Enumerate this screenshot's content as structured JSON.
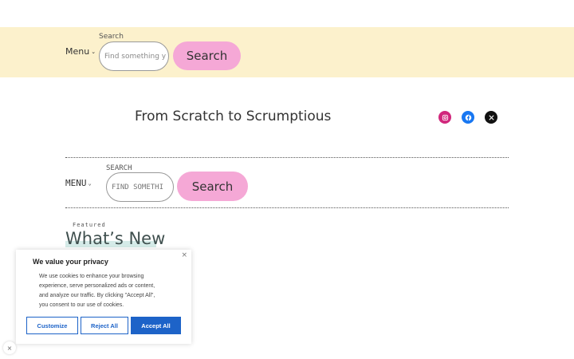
{
  "header": {
    "menu_label": "Menu",
    "search_label": "Search",
    "search_placeholder": "Find something y",
    "search_button": "Search"
  },
  "site": {
    "title": "From Scratch to Scrumptious"
  },
  "social": [
    {
      "name": "instagram-icon",
      "color": "#d1277c"
    },
    {
      "name": "facebook-icon",
      "color": "#1877f2"
    },
    {
      "name": "x-icon",
      "color": "#111111"
    }
  ],
  "nav2": {
    "menu_label": "MENU",
    "search_label": "SEARCH",
    "search_placeholder": "FIND SOMETHI",
    "search_button": "Search"
  },
  "featured": {
    "kicker": "Featured",
    "title": "What’s New"
  },
  "cookie": {
    "close": "×",
    "title": "We value your privacy",
    "lines": [
      "We use cookies to enhance your browsing",
      "experience, serve personalized ads or content,",
      "and analyze our traffic. By clicking \"Accept All\",",
      "you consent to our use of cookies."
    ],
    "customize": "Customize",
    "reject": "Reject All",
    "accept": "Accept All"
  },
  "floating_close": "×",
  "colors": {
    "band": "#fcf1cc",
    "pink": "#f5a8d6",
    "blue": "#1d63c8"
  }
}
